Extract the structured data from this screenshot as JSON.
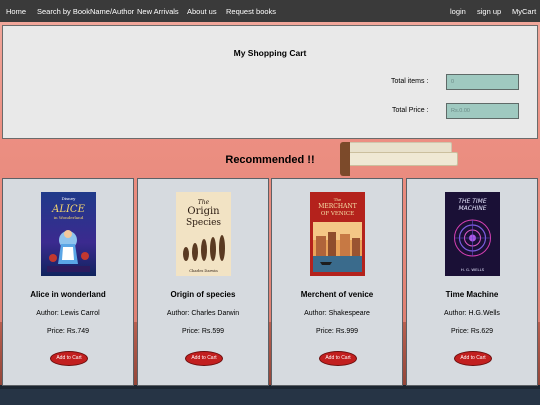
{
  "nav": {
    "left": [
      "Home",
      "Search by BookName/Author",
      "New Arrivals",
      "About us",
      "Request books"
    ],
    "right": [
      "login",
      "sign up",
      "MyCart"
    ]
  },
  "cart": {
    "title": "My Shopping Cart",
    "total_items_label": "Total items :",
    "total_items_value": "0",
    "total_price_label": "Total Price :",
    "total_price_value": "Rs.0.00"
  },
  "recommended": {
    "title": "Recommended !!",
    "books": [
      {
        "name": "Alice in wonderland",
        "author": "Author: Lewis Carrol",
        "price": "Price: Rs.749",
        "button": "Add to Cart",
        "cover": {
          "title_line1": "ALICE",
          "title_line2": "in Wonderland",
          "top": "Disney"
        }
      },
      {
        "name": "Origin of species",
        "author": "Author: Charles Darwin",
        "price": "Price: Rs.599",
        "button": "Add to Cart",
        "cover": {
          "title_line1": "The",
          "title_line2": "Origin",
          "title_line3": "Species",
          "bottom": "Charles Darwin"
        }
      },
      {
        "name": "Merchent of venice",
        "author": "Author: Shakespeare",
        "price": "Price: Rs.999",
        "button": "Add to Cart",
        "cover": {
          "title_line1": "The",
          "title_line2": "MERCHANT",
          "title_line3": "OF VENICE"
        }
      },
      {
        "name": "Time Machine",
        "author": "Author: H.G.Wells",
        "price": "Price: Rs.629",
        "button": "Add to Cart",
        "cover": {
          "title_line1": "THE TIME",
          "title_line2": "MACHINE",
          "bottom": "H. G. WELLS"
        }
      }
    ]
  },
  "colors": {
    "navbar": "#3a3a3a",
    "cart_bg": "#e9e9e9",
    "input_bg": "#9fc9c0",
    "card_bg": "#d6dadf",
    "button_red": "#c21f1f",
    "hero": "#ec8f82"
  }
}
